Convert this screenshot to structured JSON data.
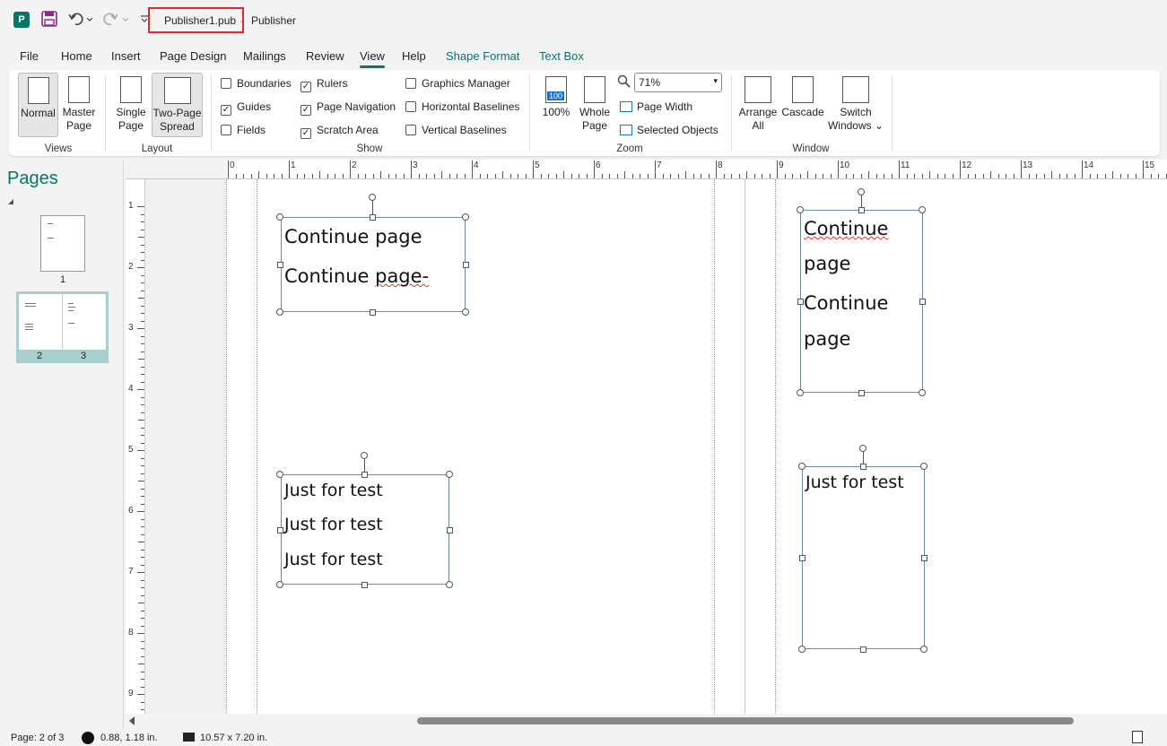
{
  "titlebar": {
    "filename": "Publisher1.pub",
    "separator": "-",
    "app_name": "Publisher"
  },
  "tabs": [
    "File",
    "Home",
    "Insert",
    "Page Design",
    "Mailings",
    "Review",
    "View",
    "Help",
    "Shape Format",
    "Text Box"
  ],
  "active_tab": "View",
  "ribbon": {
    "views": {
      "label": "Views",
      "normal": "Normal",
      "master_page_1": "Master",
      "master_page_2": "Page"
    },
    "layout": {
      "label": "Layout",
      "single_page_1": "Single",
      "single_page_2": "Page",
      "two_page_1": "Two-Page",
      "two_page_2": "Spread"
    },
    "show": {
      "label": "Show",
      "boundaries": "Boundaries",
      "guides": "Guides",
      "fields": "Fields",
      "rulers": "Rulers",
      "page_navigation": "Page Navigation",
      "scratch_area": "Scratch Area",
      "graphics_manager": "Graphics Manager",
      "horizontal_baselines": "Horizontal Baselines",
      "vertical_baselines": "Vertical Baselines"
    },
    "zoom": {
      "label": "Zoom",
      "hundred": "100%",
      "hundred_icon": "100",
      "whole_page_1": "Whole",
      "whole_page_2": "Page",
      "zoom_value": "71%",
      "page_width": "Page Width",
      "selected_objects": "Selected Objects"
    },
    "window": {
      "label": "Window",
      "arrange_1": "Arrange",
      "arrange_2": "All",
      "cascade": "Cascade",
      "switch_1": "Switch",
      "switch_2": "Windows"
    }
  },
  "checkbox_state": {
    "boundaries": false,
    "guides": true,
    "fields": false,
    "rulers": true,
    "page_navigation": true,
    "scratch_area": true,
    "graphics_manager": false,
    "horizontal_baselines": false,
    "vertical_baselines": false
  },
  "pages_pane": {
    "title": "Pages",
    "page1_num": "1",
    "page2_num": "2",
    "page3_num": "3"
  },
  "ruler_top": [
    "0",
    "1",
    "2",
    "3",
    "4",
    "5",
    "6",
    "7",
    "8",
    "9",
    "10",
    "11",
    "12",
    "13",
    "14",
    "15"
  ],
  "ruler_left": [
    "1",
    "2",
    "3",
    "4",
    "5",
    "6",
    "7",
    "8",
    "9"
  ],
  "textboxes": {
    "left_top": {
      "line1": "Continue page",
      "line2a": "Continue ",
      "line2b": "page-"
    },
    "left_bottom": {
      "line1": "Just for test",
      "line2": "Just for test",
      "line3": "Just for test"
    },
    "right_top": {
      "line1": "Continue",
      "line2": "page",
      "line3": "Continue",
      "line4": "page"
    },
    "right_bottom": {
      "line1": "Just for test"
    }
  },
  "statusbar": {
    "page": "Page: 2 of 3",
    "position": "0.88, 1.18 in.",
    "size": "10.57 x  7.20 in."
  }
}
